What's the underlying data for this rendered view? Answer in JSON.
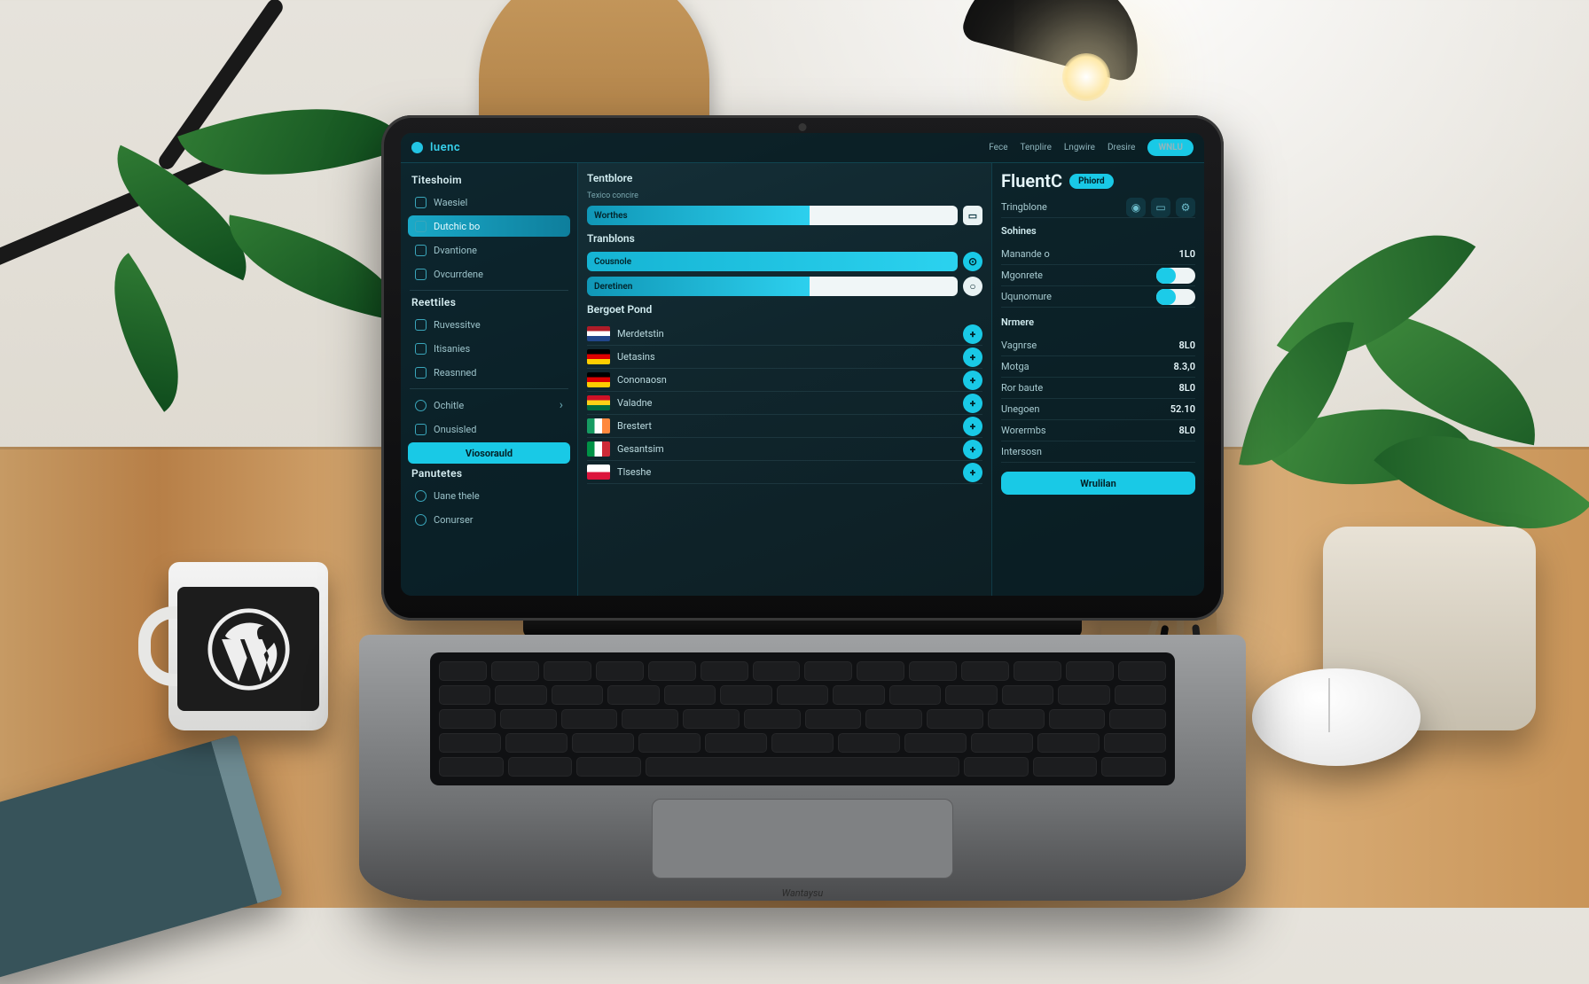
{
  "topbar": {
    "brand": "luenc",
    "nav": [
      "Fece",
      "Tenplire",
      "Lngwire",
      "Dresire"
    ],
    "cta": "WNLU"
  },
  "sidebar": {
    "section1": {
      "title": "Titeshoim",
      "items": [
        "Waesiel",
        "Dutchic bo",
        "Dvantione",
        "Ovcurrdene"
      ]
    },
    "section2": {
      "title": "Reettiles",
      "items": [
        "Ruvessitve",
        "Itisanies",
        "Reasnned"
      ]
    },
    "caret_item": "Ochitle",
    "boxed_item": "Onusisled",
    "cta": "Viosorauld",
    "section3": {
      "title": "Panutetes",
      "items": [
        "Uane thele",
        "Conurser"
      ]
    }
  },
  "center": {
    "section1": {
      "title": "Tentblore",
      "field_label": "Worthes"
    },
    "section2": {
      "title": "Tranblons",
      "field1_label": "Cousnole",
      "field2_label": "Deretinen"
    },
    "section3": {
      "title": "Bergoet Pond",
      "languages": [
        {
          "flag": "nl",
          "name": "Merdetstin"
        },
        {
          "flag": "de",
          "name": "Uetasins"
        },
        {
          "flag": "de2",
          "name": "Cononaosn"
        },
        {
          "flag": "gh",
          "name": "Valadne"
        },
        {
          "flag": "ie",
          "name": "Brestert"
        },
        {
          "flag": "it",
          "name": "Gesantsim"
        },
        {
          "flag": "pl",
          "name": "Tlseshe"
        }
      ]
    }
  },
  "right": {
    "title": "FluentC",
    "badge": "Phiord",
    "sub": {
      "label": "Tringblone"
    },
    "settings": {
      "title": "Sohines",
      "rows": [
        {
          "label": "Manande o",
          "value": "1L0"
        },
        {
          "label": "Mgonrete",
          "toggle": true
        },
        {
          "label": "Uqunomure",
          "toggle": true
        }
      ]
    },
    "stats": {
      "title": "Nrmere",
      "rows": [
        {
          "label": "Vagnrse",
          "value": "8L0"
        },
        {
          "label": "Motga",
          "value": "8.3,0"
        },
        {
          "label": "Ror baute",
          "value": "8L0"
        },
        {
          "label": "Unegoen",
          "value": "52.10"
        },
        {
          "label": "Worermbs",
          "value": "8L0"
        },
        {
          "label": "Intersosn",
          "value": ""
        }
      ]
    },
    "cta": "Wrulilan"
  },
  "laptop_brand": "Wantaysu"
}
